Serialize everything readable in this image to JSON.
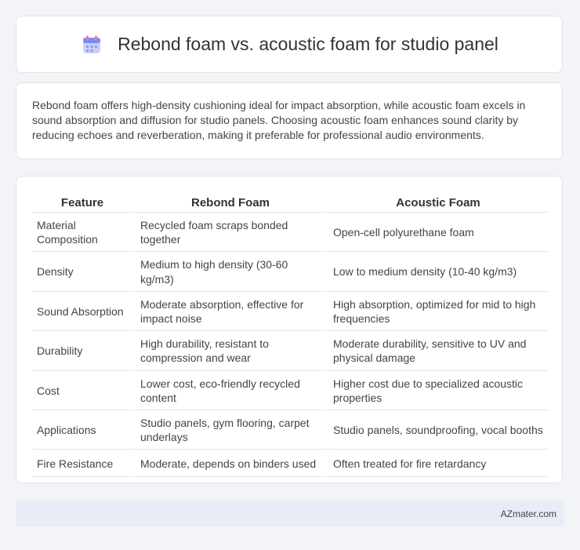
{
  "header": {
    "title": "Rebond foam vs. acoustic foam for studio panel",
    "icon": "calendar-icon"
  },
  "summary": "Rebond foam offers high-density cushioning ideal for impact absorption, while acoustic foam excels in sound absorption and diffusion for studio panels. Choosing acoustic foam enhances sound clarity by reducing echoes and reverberation, making it preferable for professional audio environments.",
  "table": {
    "headers": [
      "Feature",
      "Rebond Foam",
      "Acoustic Foam"
    ],
    "rows": [
      [
        "Material Composition",
        "Recycled foam scraps bonded together",
        "Open-cell polyurethane foam"
      ],
      [
        "Density",
        "Medium to high density (30-60 kg/m3)",
        "Low to medium density (10-40 kg/m3)"
      ],
      [
        "Sound Absorption",
        "Moderate absorption, effective for impact noise",
        "High absorption, optimized for mid to high frequencies"
      ],
      [
        "Durability",
        "High durability, resistant to compression and wear",
        "Moderate durability, sensitive to UV and physical damage"
      ],
      [
        "Cost",
        "Lower cost, eco-friendly recycled content",
        "Higher cost due to specialized acoustic properties"
      ],
      [
        "Applications",
        "Studio panels, gym flooring, carpet underlays",
        "Studio panels, soundproofing, vocal booths"
      ],
      [
        "Fire Resistance",
        "Moderate, depends on binders used",
        "Often treated for fire retardancy"
      ]
    ]
  },
  "footer": {
    "brand": "AZmater.com"
  },
  "colors": {
    "background": "#f2f4f8",
    "card": "#ffffff",
    "footer": "#e8ecf6",
    "icon_primary": "#7b8cf0",
    "icon_secondary": "#e57ab0"
  }
}
